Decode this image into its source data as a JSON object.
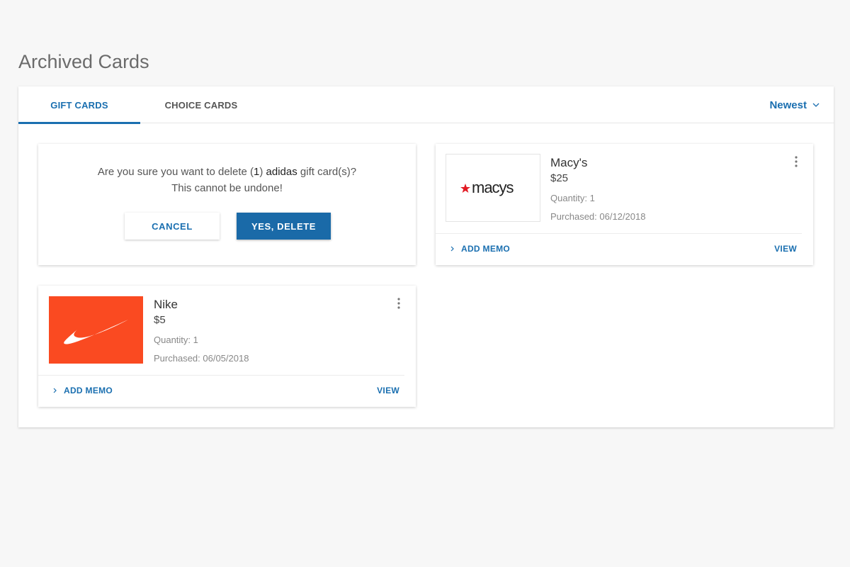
{
  "page": {
    "title": "Archived Cards"
  },
  "tabs": [
    {
      "label": "GIFT CARDS",
      "active": true
    },
    {
      "label": "CHOICE CARDS",
      "active": false
    }
  ],
  "sort": {
    "label": "Newest",
    "icon": "chevron-down-icon"
  },
  "confirm": {
    "prefix": "Are you sure you want to delete (",
    "count": "1",
    "middle": ") ",
    "brand": "adidas",
    "suffix": " gift card(s)?",
    "line2": "This cannot be undone!",
    "cancel_label": "CANCEL",
    "delete_label": "YES, DELETE"
  },
  "cards": [
    {
      "name": "Macy's",
      "amount": "$25",
      "quantity": "Quantity: 1",
      "purchased": "Purchased: 06/12/2018",
      "logo_text": "macys",
      "memo_label": "ADD MEMO",
      "view_label": "VIEW"
    },
    {
      "name": "Nike",
      "amount": "$5",
      "quantity": "Quantity: 1",
      "purchased": "Purchased: 06/05/2018",
      "memo_label": "ADD MEMO",
      "view_label": "VIEW"
    }
  ],
  "colors": {
    "accent": "#1a6fb0",
    "nike_bg": "#fa4a21",
    "macys_star": "#e21a23"
  }
}
